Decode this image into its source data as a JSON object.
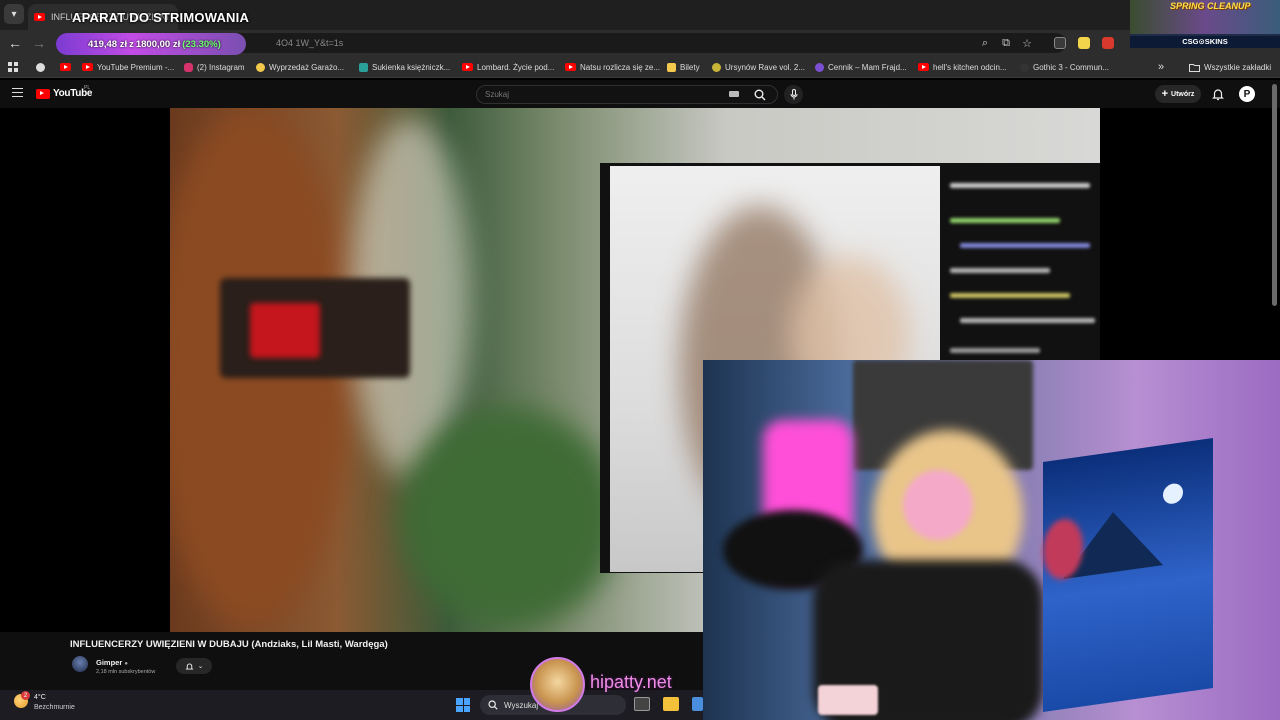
{
  "browser": {
    "tab_title": "INFLUENCERZY UWIĘZIENI",
    "tab_close": "×",
    "address_text": "4O4 1W_Y&t=1s",
    "bookmarks": [
      "YouTube Premium -...",
      "(2) Instagram",
      "Wyprzedaż Garażo...",
      "Sukienka księżniczk...",
      "Lombard. Życie pod...",
      "Natsu rozlicza się ze...",
      "Bilety",
      "Ursynów Rave vol. 2...",
      "Cennik – Mam Frajd...",
      "hell's kitchen odcin...",
      "Gothic 3 - Commun..."
    ],
    "all_bookmarks": "Wszystkie zakładki",
    "overflow_chevron": "»"
  },
  "youtube": {
    "logo_text": "YouTube",
    "region": "PL",
    "search_placeholder": "Szukaj",
    "create_label": "Utwórz",
    "account_initial": "P"
  },
  "video": {
    "title": "INFLUENCERZY UWIĘZIENI W DUBAJU (Andziaks, Lil Masti, Wardęga)",
    "channel_name": "Gimper",
    "subscribers": "2,18 mln subskrybentów"
  },
  "overlay": {
    "stream_title": "APARAT DO STRIMOWANIA",
    "goal_current": "419,48 zł",
    "goal_sep": "z",
    "goal_target": "1800,00 zł",
    "goal_percent": "(23.30%)",
    "sponsor_promo": "SPRING CLEANUP",
    "sponsor_brand": "CSG⊙SKINS",
    "watermark": "hipatty.net"
  },
  "taskbar": {
    "weather_badge": "2",
    "temperature": "4°C",
    "condition": "Bezchmurnie",
    "search_placeholder": "Wyszukaj"
  },
  "colors": {
    "youtube_red": "#ff0000",
    "goal_green": "#6dff6d",
    "watermark_pink": "#f08be6"
  }
}
